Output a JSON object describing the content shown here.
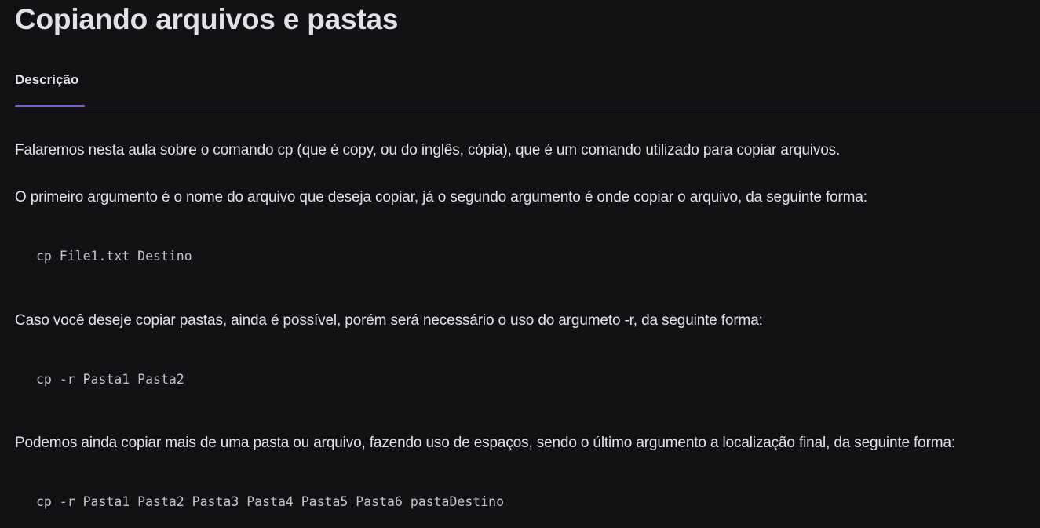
{
  "page": {
    "title": "Copiando arquivos e pastas"
  },
  "tabs": [
    {
      "label": "Descrição",
      "active": true
    }
  ],
  "content": {
    "p1": "Falaremos nesta aula sobre o comando cp (que é copy, ou do inglês, cópia), que é um comando utilizado para copiar arquivos.",
    "p2": "O primeiro argumento é o nome do arquivo que deseja copiar, já o segundo argumento é onde copiar o arquivo, da seguinte forma:",
    "code1": "cp File1.txt Destino",
    "p3": "Caso você deseje copiar pastas, ainda é possível, porém será necessário o uso do argumeto -r, da seguinte forma:",
    "code2": "cp -r Pasta1 Pasta2",
    "p4": "Podemos ainda copiar mais de uma pasta ou arquivo, fazendo uso de espaços, sendo o último argumento a localização final, da seguinte forma:",
    "code3": "cp -r Pasta1 Pasta2 Pasta3 Pasta4 Pasta5 Pasta6 pastaDestino"
  },
  "colors": {
    "background": "#121214",
    "text": "#e1e1e6",
    "accent": "#8257e5",
    "divider": "#29292e"
  }
}
